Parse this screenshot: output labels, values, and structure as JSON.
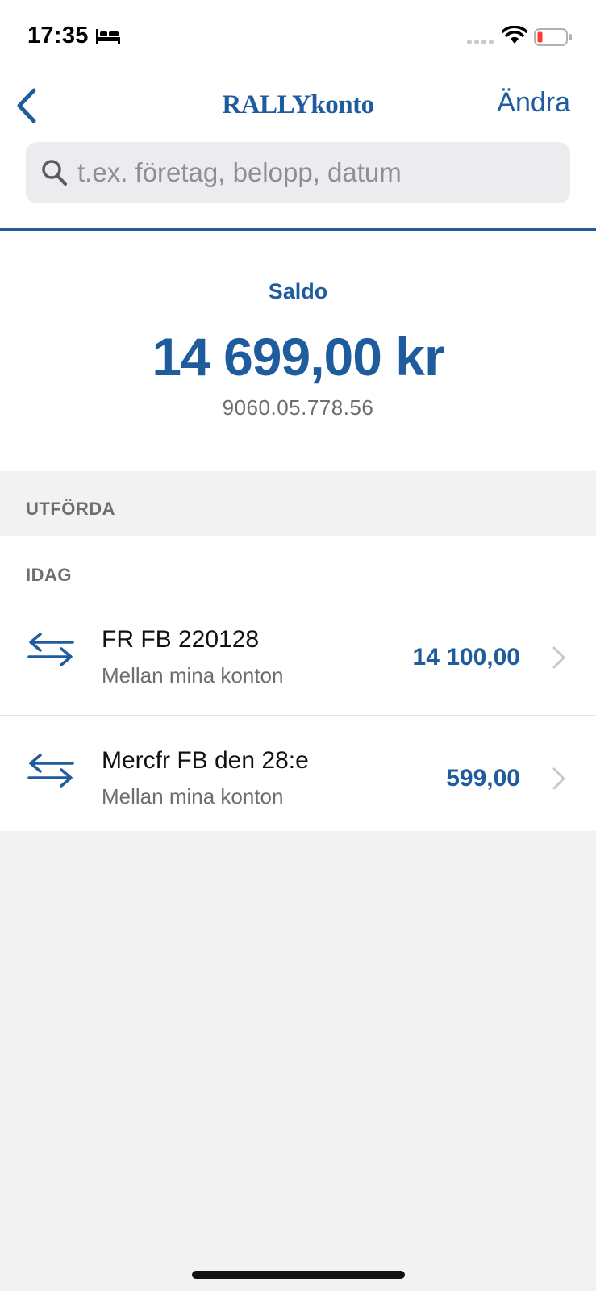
{
  "status_bar": {
    "time": "17:35"
  },
  "header": {
    "brand_bold": "RALLY",
    "brand_rest": "konto",
    "edit_label": "Ändra"
  },
  "search": {
    "placeholder": "t.ex. företag, belopp, datum",
    "value": ""
  },
  "balance": {
    "label": "Saldo",
    "amount": "14 699,00 kr",
    "account_number": "9060.05.778.56"
  },
  "section": {
    "title": "UTFÖRDA"
  },
  "transactions": {
    "group_title": "IDAG",
    "items": [
      {
        "title": "FR FB 220128",
        "subtitle": "Mellan mina konton",
        "amount": "14 100,00",
        "icon": "transfer-arrows-icon"
      },
      {
        "title": "Mercfr FB den 28:e",
        "subtitle": "Mellan mina konton",
        "amount": "599,00",
        "icon": "transfer-arrows-icon"
      }
    ]
  },
  "colors": {
    "brand_blue": "#1f5c9e",
    "background": "#f2f2f2",
    "secondary_text": "#6d6d72"
  }
}
